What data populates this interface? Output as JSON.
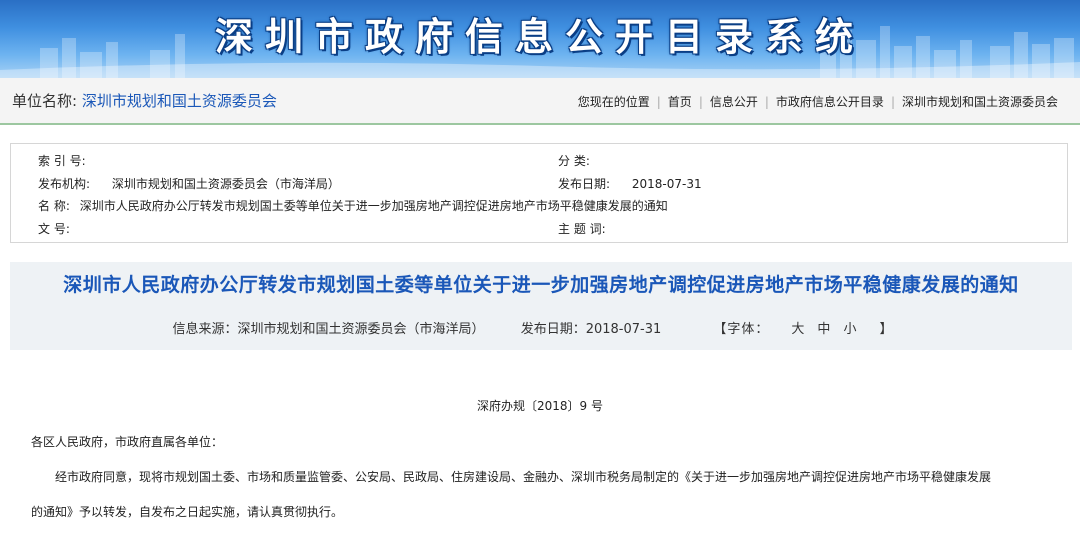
{
  "banner": {
    "title": "深圳市政府信息公开目录系统"
  },
  "unit_bar": {
    "label": "单位名称:",
    "value": "深圳市规划和国土资源委员会"
  },
  "breadcrumb": {
    "prefix": "您现在的位置",
    "items": [
      "首页",
      "信息公开",
      "市政府信息公开目录",
      "深圳市规划和国土资源委员会"
    ]
  },
  "meta": {
    "index_label": "索 引 号:",
    "index_value": "",
    "category_label": "分 类:",
    "category_value": "",
    "publisher_label": "发布机构:",
    "publisher_value": "深圳市规划和国土资源委员会（市海洋局）",
    "date_label": "发布日期:",
    "date_value": "2018-07-31",
    "name_label": "名 称:",
    "name_value": "深圳市人民政府办公厅转发市规划国土委等单位关于进一步加强房地产调控促进房地产市场平稳健康发展的通知",
    "docno_label": "文 号:",
    "docno_value": "",
    "topic_label": "主 题 词:",
    "topic_value": ""
  },
  "article": {
    "title": "深圳市人民政府办公厅转发市规划国土委等单位关于进一步加强房地产调控促进房地产市场平稳健康发展的通知",
    "source": "信息来源：深圳市规划和国土资源委员会（市海洋局）",
    "date": "发布日期：2018-07-31",
    "font_open": "【字体：",
    "font_large": "大",
    "font_medium": "中",
    "font_small": "小",
    "font_close": "】"
  },
  "body": {
    "doc_number": "深府办规〔2018〕9 号",
    "salutation": "各区人民政府，市政府直属各单位：",
    "para1_line1": "经市政府同意，现将市规划国土委、市场和质量监管委、公安局、民政局、住房建设局、金融办、深圳市税务局制定的《关于进一步加强房地产调控促进房地产市场平稳健康发展",
    "para1_line2": "的通知》予以转发，自发布之日起实施，请认真贯彻执行。"
  },
  "colors": {
    "link_blue": "#1a57b8",
    "divider_green": "#9cc7a0",
    "banner_blue": "#3f8fe0"
  }
}
